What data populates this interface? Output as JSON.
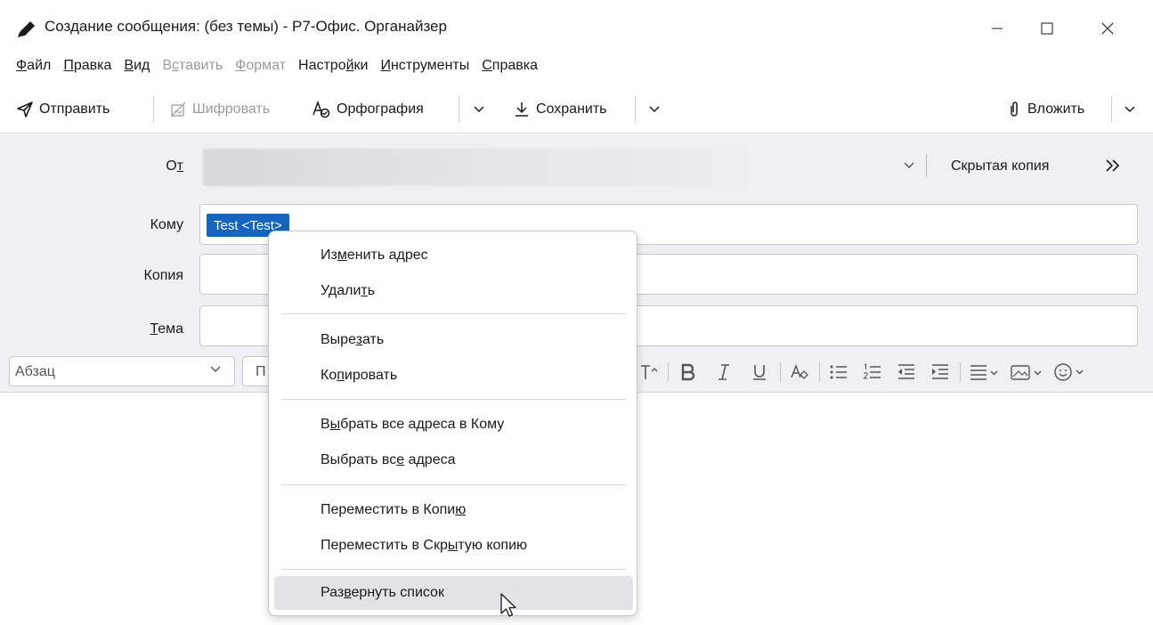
{
  "window": {
    "title": "Создание сообщения: (без темы) - Р7-Офис. Органайзер"
  },
  "menubar": {
    "file": [
      "Ф",
      "айл"
    ],
    "edit": [
      "П",
      "равка"
    ],
    "view": [
      "В",
      "ид"
    ],
    "insert": [
      "В",
      "с",
      "тавить"
    ],
    "format": [
      "Ф",
      "ормат"
    ],
    "settings": [
      "Настро",
      "й",
      "ки"
    ],
    "tools": [
      "И",
      "нструменты"
    ],
    "help": [
      "С",
      "правка"
    ]
  },
  "toolbar": {
    "send": "Отправить",
    "encrypt": "Шифровать",
    "spelling": "Орфография",
    "save": "Сохранить",
    "attach": "Вложить"
  },
  "header": {
    "from_label": [
      "О",
      "т"
    ],
    "to_label": "Кому",
    "cc_label": "Копия",
    "subject_label": [
      "Т",
      "ема"
    ],
    "recipient_pill": "Test <Test>",
    "bcc_link": "Скрытая копия"
  },
  "format_bar": {
    "paragraph": "Абзац",
    "font_partial": "П"
  },
  "context_menu": {
    "items": [
      [
        "Из",
        "м",
        "енить адрес"
      ],
      [
        "Удали",
        "т",
        "ь"
      ],
      [
        "Выре",
        "з",
        "ать"
      ],
      [
        "Ко",
        "п",
        "ировать"
      ],
      [
        "В",
        "ы",
        "брать все адреса в Кому"
      ],
      [
        "Выбрать вс",
        "е",
        " адреса"
      ],
      [
        "Переместить в Копи",
        "ю",
        ""
      ],
      [
        "Переместить в Скр",
        "ы",
        "тую копию"
      ],
      [
        "Раз",
        "в",
        "ернуть список"
      ]
    ]
  },
  "colors": {
    "accent": "#1565c0",
    "header_bg": "#f0f0f4",
    "menu_hover": "#e3e3e7"
  }
}
